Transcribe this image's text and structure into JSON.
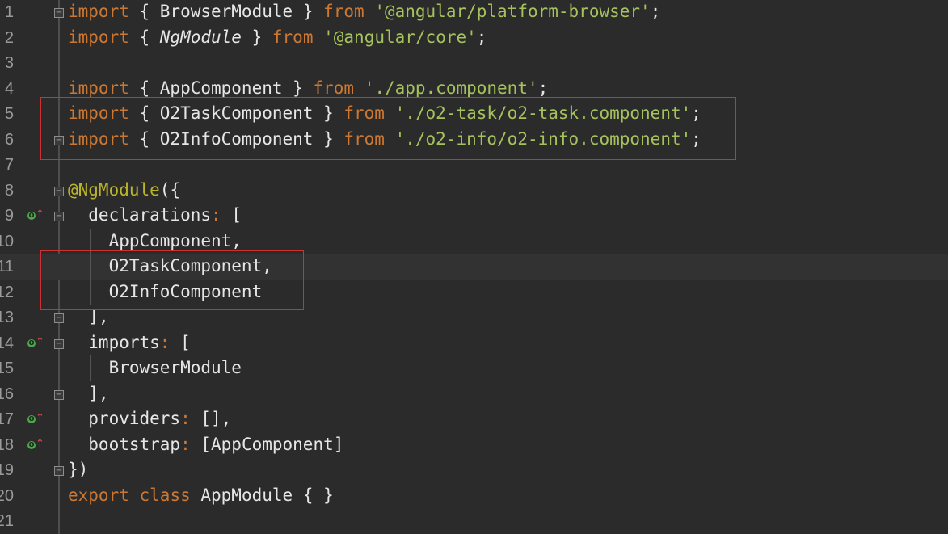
{
  "editor": {
    "current_line": 11,
    "lines": [
      {
        "num": "1",
        "tokens": [
          {
            "t": "import",
            "c": "kw"
          },
          {
            "t": " { BrowserModule } "
          },
          {
            "t": "from",
            "c": "kw"
          },
          {
            "t": " "
          },
          {
            "t": "'@angular/platform-browser'",
            "c": "str"
          },
          {
            "t": ";"
          }
        ]
      },
      {
        "num": "2",
        "tokens": [
          {
            "t": "import",
            "c": "kw"
          },
          {
            "t": " { "
          },
          {
            "t": "NgModule",
            "c": "it"
          },
          {
            "t": " } "
          },
          {
            "t": "from",
            "c": "kw"
          },
          {
            "t": " "
          },
          {
            "t": "'@angular/core'",
            "c": "str"
          },
          {
            "t": ";"
          }
        ]
      },
      {
        "num": "3",
        "tokens": []
      },
      {
        "num": "4",
        "tokens": [
          {
            "t": "import",
            "c": "kw"
          },
          {
            "t": " { AppComponent } "
          },
          {
            "t": "from",
            "c": "kw"
          },
          {
            "t": " "
          },
          {
            "t": "'./app.component'",
            "c": "str"
          },
          {
            "t": ";"
          }
        ]
      },
      {
        "num": "5",
        "tokens": [
          {
            "t": "import",
            "c": "kw"
          },
          {
            "t": " { O2TaskComponent } "
          },
          {
            "t": "from",
            "c": "kw"
          },
          {
            "t": " "
          },
          {
            "t": "'./o2-task/o2-task.component'",
            "c": "str"
          },
          {
            "t": ";"
          }
        ]
      },
      {
        "num": "6",
        "tokens": [
          {
            "t": "import",
            "c": "kw"
          },
          {
            "t": " { O2InfoComponent } "
          },
          {
            "t": "from",
            "c": "kw"
          },
          {
            "t": " "
          },
          {
            "t": "'./o2-info/o2-info.component'",
            "c": "str"
          },
          {
            "t": ";"
          }
        ]
      },
      {
        "num": "7",
        "tokens": []
      },
      {
        "num": "8",
        "tokens": [
          {
            "t": "@NgModule",
            "c": "dec"
          },
          {
            "t": "({"
          }
        ]
      },
      {
        "num": "9",
        "tokens": [
          {
            "t": "  declarations"
          },
          {
            "t": ":",
            "c": "kw"
          },
          {
            "t": " ["
          }
        ]
      },
      {
        "num": "10",
        "tokens": [
          {
            "t": "    AppComponent,"
          }
        ]
      },
      {
        "num": "11",
        "tokens": [
          {
            "t": "    O2TaskComponent,"
          }
        ]
      },
      {
        "num": "12",
        "tokens": [
          {
            "t": "    O2InfoComponent"
          }
        ]
      },
      {
        "num": "13",
        "tokens": [
          {
            "t": "  ],"
          }
        ]
      },
      {
        "num": "14",
        "tokens": [
          {
            "t": "  imports"
          },
          {
            "t": ":",
            "c": "kw"
          },
          {
            "t": " ["
          }
        ]
      },
      {
        "num": "15",
        "tokens": [
          {
            "t": "    BrowserModule"
          }
        ]
      },
      {
        "num": "16",
        "tokens": [
          {
            "t": "  ],"
          }
        ]
      },
      {
        "num": "17",
        "tokens": [
          {
            "t": "  providers"
          },
          {
            "t": ":",
            "c": "kw"
          },
          {
            "t": " [],"
          }
        ]
      },
      {
        "num": "18",
        "tokens": [
          {
            "t": "  bootstrap"
          },
          {
            "t": ":",
            "c": "kw"
          },
          {
            "t": " [AppComponent]"
          }
        ]
      },
      {
        "num": "19",
        "tokens": [
          {
            "t": "})"
          }
        ]
      },
      {
        "num": "20",
        "tokens": [
          {
            "t": "export",
            "c": "kw"
          },
          {
            "t": " "
          },
          {
            "t": "class",
            "c": "kw"
          },
          {
            "t": " AppModule { }"
          }
        ]
      },
      {
        "num": "21",
        "tokens": []
      }
    ],
    "fold_markers": [
      {
        "line": 1,
        "glyph": "−"
      },
      {
        "line": 6,
        "glyph": "−"
      },
      {
        "line": 8,
        "glyph": "−"
      },
      {
        "line": 9,
        "glyph": "−"
      },
      {
        "line": 13,
        "glyph": "−"
      },
      {
        "line": 14,
        "glyph": "−"
      },
      {
        "line": 16,
        "glyph": "−"
      },
      {
        "line": 19,
        "glyph": "−"
      }
    ],
    "override_markers": [
      {
        "line": 9,
        "badge": "O",
        "arrow": "↑"
      },
      {
        "line": 14,
        "badge": "O",
        "arrow": "↑"
      },
      {
        "line": 17,
        "badge": "O",
        "arrow": "↑"
      },
      {
        "line": 18,
        "badge": "O",
        "arrow": "↑"
      }
    ],
    "highlight_color": "#d03030"
  }
}
